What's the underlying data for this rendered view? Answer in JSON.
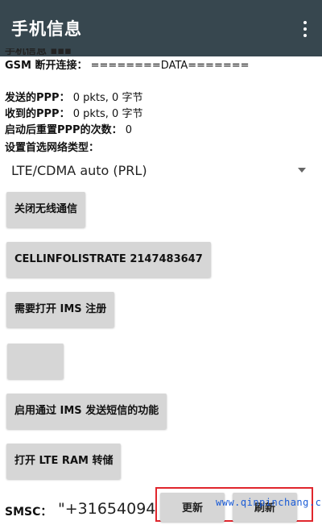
{
  "app_bar": {
    "title": "手机信息"
  },
  "status": {
    "gsm_label": "GSM 断开连接：",
    "gsm_value": "========DATA=======",
    "sent_ppp_label": "发送的PPP：",
    "sent_ppp_value": "0 pkts, 0 字节",
    "recv_ppp_label": "收到的PPP：",
    "recv_ppp_value": "0 pkts, 0 字节",
    "reset_label": "启动后重置PPP的次数：",
    "reset_value": "0",
    "pref_network_label": "设置首选网络类型："
  },
  "network_type": {
    "selected": "LTE/CDMA auto (PRL)"
  },
  "buttons": {
    "radio_off": "关闭无线通信",
    "cellinfo_rate": "CELLINFOLISTRATE 2147483647",
    "ims_register": "需要打开 IMS 注册",
    "blank": "",
    "ims_sms": "启用通过 IMS 发送短信的功能",
    "lte_ram_dump": "打开 LTE RAM 转储"
  },
  "smsc": {
    "label": "SMSC：",
    "value": "\"+31654094",
    "update_button": "更新",
    "refresh_button": "刷新"
  },
  "watermark": {
    "text": "www.qinpinchang.com"
  },
  "colors": {
    "app_bar": "#37474f",
    "button_bg": "#d6d6d6",
    "highlight_box": "#e0262d",
    "watermark": "#1a5bd6"
  }
}
